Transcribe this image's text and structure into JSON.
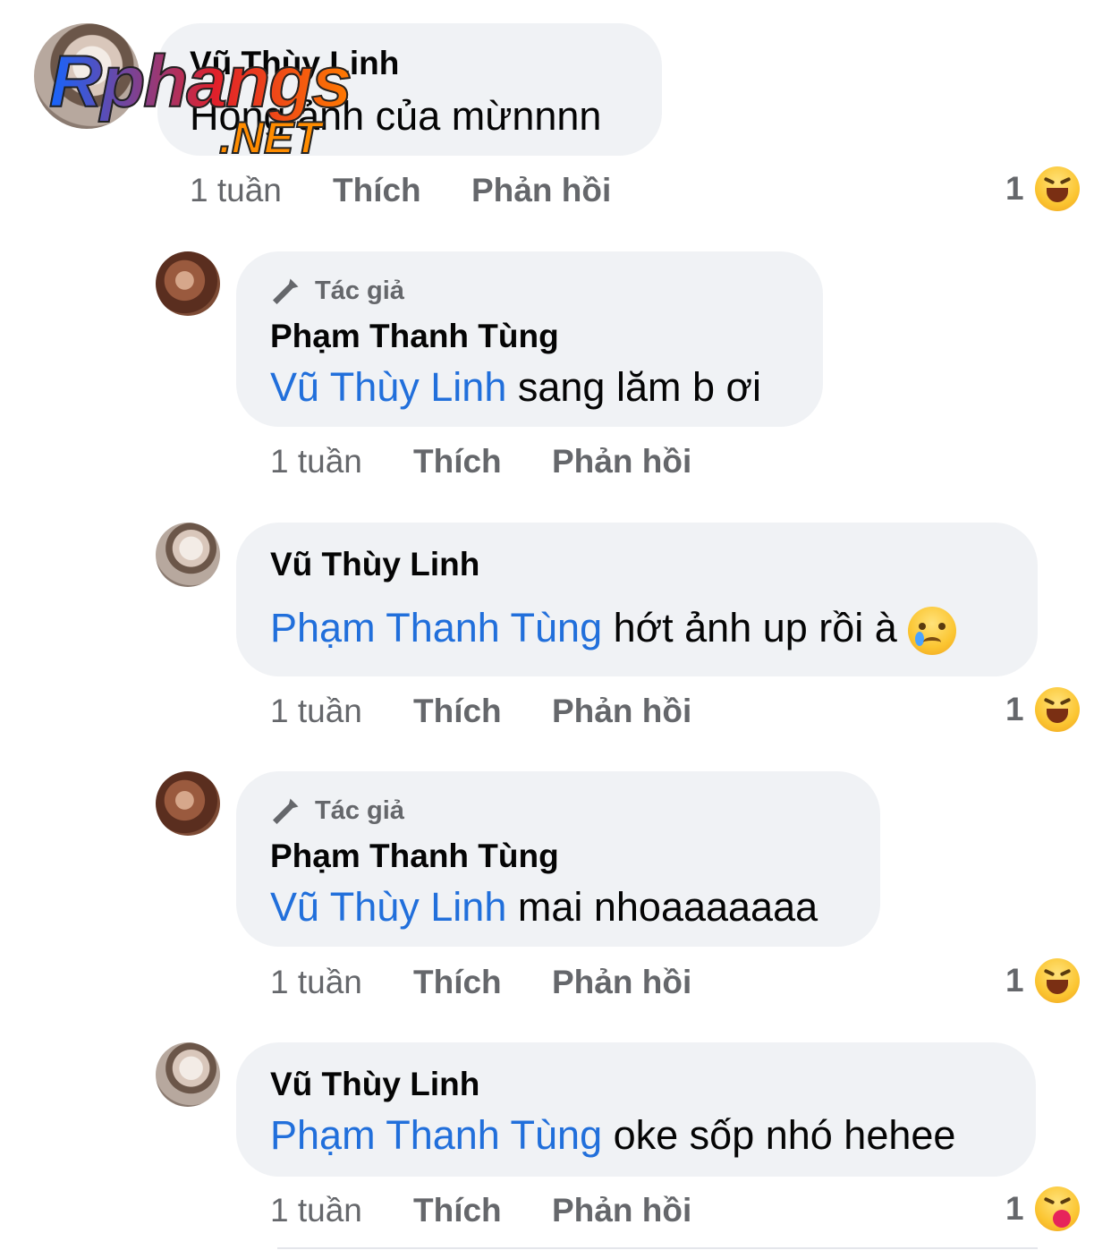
{
  "comments": [
    {
      "name": "Vũ Thùy Linh",
      "text": "Hóng ảnh của mừnnnn",
      "time": "1 tuần",
      "like": "Thích",
      "reply": "Phản hồi",
      "reaction_count": "1"
    },
    {
      "author_badge": "Tác giả",
      "name": "Phạm Thanh Tùng",
      "mention": "Vũ Thùy Linh",
      "text": " sang lăm b ơi",
      "time": "1 tuần",
      "like": "Thích",
      "reply": "Phản hồi"
    },
    {
      "name": "Vũ Thùy Linh",
      "mention": "Phạm Thanh Tùng",
      "text": " hớt ảnh up rồi à",
      "time": "1 tuần",
      "like": "Thích",
      "reply": "Phản hồi",
      "reaction_count": "1"
    },
    {
      "author_badge": "Tác giả",
      "name": "Phạm Thanh Tùng",
      "mention": "Vũ Thùy Linh",
      "text": " mai nhoaaaaaaa",
      "time": "1 tuần",
      "like": "Thích",
      "reply": "Phản hồi",
      "reaction_count": "1"
    },
    {
      "name": "Vũ Thùy Linh",
      "mention": "Phạm Thanh Tùng",
      "text": " oke sốp nhó hehee",
      "time": "1 tuần",
      "like": "Thích",
      "reply": "Phản hồi",
      "reaction_count": "1"
    }
  ],
  "watermark": {
    "main": "Rphangs",
    "sub": ".NET"
  },
  "colors": {
    "mention": "#216fdb",
    "bubble": "#f0f2f5",
    "meta": "#65676b"
  }
}
